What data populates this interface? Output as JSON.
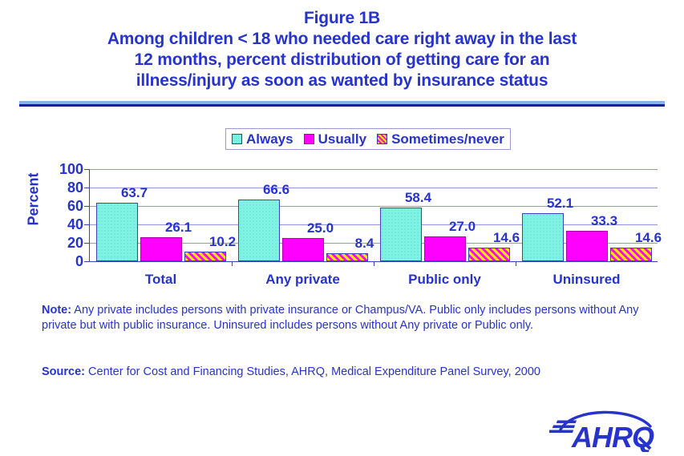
{
  "title": {
    "line1": "Figure 1B",
    "line2": "Among children < 18 who needed care right away in the last",
    "line3": "12 months, percent distribution of getting care for an",
    "line4": "illness/injury as soon as wanted by insurance status"
  },
  "legend": {
    "items": [
      {
        "label": "Always",
        "swatch": "always-swatch-icon",
        "color": "#7ff2e3"
      },
      {
        "label": "Usually",
        "swatch": "usually-swatch-icon",
        "color": "#ff00ff"
      },
      {
        "label": "Sometimes/never",
        "swatch": "sometimes-never-swatch-icon",
        "color": "#ffe800"
      }
    ]
  },
  "notes": {
    "note_label": "Note:",
    "note_text": " Any private includes persons with private insurance or Champus/VA.  Public only includes persons without Any private but with public insurance. Uninsured includes persons without Any private or Public only.",
    "source_label": "Source:",
    "source_text": " Center for Cost and Financing Studies, AHRQ, Medical Expenditure Panel Survey, 2000"
  },
  "logo": {
    "name": "ahrq-logo",
    "text": "AHRQ",
    "color": "#2633cc"
  },
  "chart_data": {
    "type": "bar",
    "title": "Among children < 18 who needed care right away in the last 12 months, percent distribution of getting care for an illness/injury as soon as wanted by insurance status",
    "xlabel": "",
    "ylabel": "Percent",
    "ylim": [
      0,
      100
    ],
    "yticks": [
      0,
      20,
      40,
      60,
      80,
      100
    ],
    "grid": true,
    "legend_position": "top-center",
    "categories": [
      "Total",
      "Any private",
      "Public only",
      "Uninsured"
    ],
    "series": [
      {
        "name": "Always",
        "color": "#7ff2e3",
        "values": [
          63.7,
          66.6,
          58.4,
          52.1
        ]
      },
      {
        "name": "Usually",
        "color": "#ff00ff",
        "values": [
          26.1,
          25.0,
          27.0,
          33.3
        ]
      },
      {
        "name": "Sometimes/never",
        "color": "#ffe800",
        "values": [
          10.2,
          8.4,
          14.6,
          14.6
        ]
      }
    ],
    "value_labels": [
      [
        "63.7",
        "26.1",
        "10.2"
      ],
      [
        "66.6",
        "25.0",
        "8.4"
      ],
      [
        "58.4",
        "27.0",
        "14.6"
      ],
      [
        "52.1",
        "33.3",
        "14.6"
      ]
    ]
  }
}
